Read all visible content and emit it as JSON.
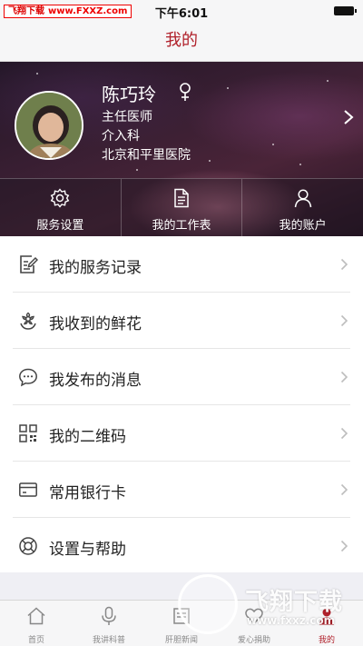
{
  "status_bar": {
    "time": "下午6:01",
    "watermark_label": "飞翔下载",
    "watermark_url": "www.FXXZ.com"
  },
  "nav": {
    "title": "我的"
  },
  "profile": {
    "name": "陈巧玲",
    "gender_symbol": "♀",
    "title": "主任医师",
    "department": "介入科",
    "hospital": "北京和平里医院"
  },
  "quick_actions": [
    {
      "label": "服务设置",
      "icon": "gear-icon"
    },
    {
      "label": "我的工作表",
      "icon": "document-icon"
    },
    {
      "label": "我的账户",
      "icon": "user-icon"
    }
  ],
  "menu": [
    {
      "label": "我的服务记录",
      "icon": "edit-note-icon"
    },
    {
      "label": "我收到的鲜花",
      "icon": "flower-icon"
    },
    {
      "label": "我发布的消息",
      "icon": "chat-bubble-icon"
    },
    {
      "label": "我的二维码",
      "icon": "qr-code-icon"
    },
    {
      "label": "常用银行卡",
      "icon": "bank-card-icon"
    },
    {
      "label": "设置与帮助",
      "icon": "lifebuoy-icon"
    }
  ],
  "tabs": [
    {
      "label": "首页",
      "icon": "home-icon",
      "active": false
    },
    {
      "label": "我讲科普",
      "icon": "microphone-icon",
      "active": false
    },
    {
      "label": "肝胆新闻",
      "icon": "news-icon",
      "active": false
    },
    {
      "label": "爱心捐助",
      "icon": "heart-icon",
      "active": false
    },
    {
      "label": "我的",
      "icon": "person-icon",
      "active": true
    }
  ],
  "overlay_watermark": {
    "text": "飞翔下载",
    "url": "www.fxxz.com"
  },
  "colors": {
    "accent": "#b0202a",
    "menu_bg": "#ffffff",
    "page_bg": "#efeff4"
  }
}
